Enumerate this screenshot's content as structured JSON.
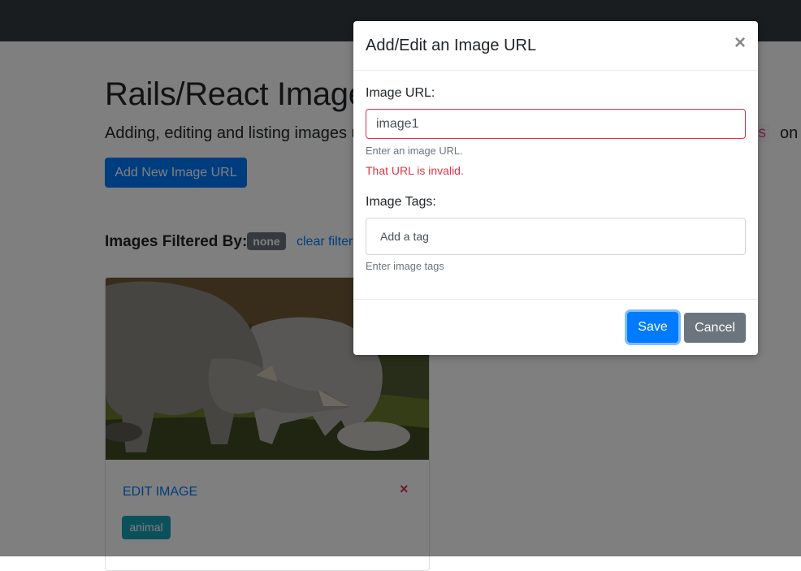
{
  "page": {
    "title": "Rails/React Image Gallery",
    "lead": "Adding, editing and listing images using Rails and React with tags and URLs",
    "code_fragment": "Is",
    "lead_tail": "on",
    "add_button": "Add New Image URL",
    "filter_label": "Images Filtered By:",
    "filter_badge": "none",
    "clear_filter": "clear filter"
  },
  "card": {
    "image_icon": "rhino-photo",
    "edit_link": "EDIT IMAGE",
    "delete_icon": "×",
    "tag": "animal"
  },
  "modal": {
    "title": "Add/Edit an Image URL",
    "close_icon": "×",
    "url_label": "Image URL:",
    "url_value": "image1",
    "url_help": "Enter an image URL.",
    "url_error": "That URL is invalid.",
    "tags_label": "Image Tags:",
    "tags_placeholder": "Add a tag",
    "tags_help": "Enter image tags",
    "save_button": "Save",
    "cancel_button": "Cancel"
  },
  "colors": {
    "primary": "#007bff",
    "danger": "#dc3545",
    "secondary": "#6c757d",
    "info": "#17a2b8",
    "navbar": "#343a40"
  }
}
